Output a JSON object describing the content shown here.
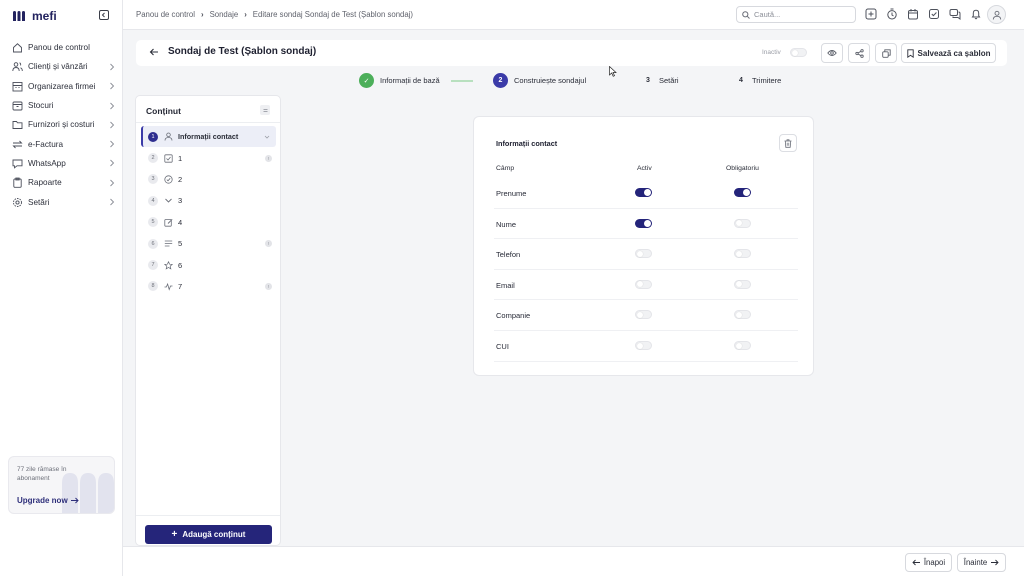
{
  "app": {
    "logo_text": "mefi"
  },
  "sidebar": {
    "items": [
      {
        "label": "Panou de control",
        "icon": "home-icon",
        "has_chevron": false
      },
      {
        "label": "Clienți și vânzări",
        "icon": "users-icon",
        "has_chevron": true
      },
      {
        "label": "Organizarea firmei",
        "icon": "building-icon",
        "has_chevron": true
      },
      {
        "label": "Stocuri",
        "icon": "box-icon",
        "has_chevron": true
      },
      {
        "label": "Furnizori și costuri",
        "icon": "folder-icon",
        "has_chevron": true
      },
      {
        "label": "e-Factura",
        "icon": "exchange-icon",
        "has_chevron": true
      },
      {
        "label": "WhatsApp",
        "icon": "chat-icon",
        "has_chevron": true
      },
      {
        "label": "Rapoarte",
        "icon": "clipboard-icon",
        "has_chevron": true
      },
      {
        "label": "Setări",
        "icon": "gear-icon",
        "has_chevron": true
      }
    ],
    "upgrade": {
      "text": "77 zile rămase în abonament",
      "link": "Upgrade now"
    }
  },
  "topbar": {
    "breadcrumb": [
      "Panou de control",
      "Sondaje",
      "Editare sondaj Sondaj de Test (Șablon sondaj)"
    ],
    "search_placeholder": "Caută..."
  },
  "header": {
    "title": "Sondaj de Test (Șablon sondaj)",
    "inactive_label": "Inactiv",
    "save_template_label": "Salvează ca șablon"
  },
  "stepper": [
    {
      "num": "✓",
      "label": "Informații de bază",
      "state": "done"
    },
    {
      "num": "2",
      "label": "Construiește sondajul",
      "state": "active"
    },
    {
      "num": "3",
      "label": "Setări",
      "state": "idle"
    },
    {
      "num": "4",
      "label": "Trimitere",
      "state": "idle"
    }
  ],
  "content_panel": {
    "title": "Conținut",
    "items": [
      {
        "num": "1",
        "label": "Informații contact",
        "icon": "person-icon",
        "selected": true,
        "required": false,
        "caret": true
      },
      {
        "num": "2",
        "label": "1",
        "icon": "checkbox-icon",
        "selected": false,
        "required": true,
        "caret": false
      },
      {
        "num": "3",
        "label": "2",
        "icon": "check-circle-icon",
        "selected": false,
        "required": false,
        "caret": false
      },
      {
        "num": "4",
        "label": "3",
        "icon": "chevron-down-icon",
        "selected": false,
        "required": false,
        "caret": false
      },
      {
        "num": "5",
        "label": "4",
        "icon": "edit-icon",
        "selected": false,
        "required": false,
        "caret": false
      },
      {
        "num": "6",
        "label": "5",
        "icon": "lines-icon",
        "selected": false,
        "required": true,
        "caret": false
      },
      {
        "num": "7",
        "label": "6",
        "icon": "star-icon",
        "selected": false,
        "required": false,
        "caret": false
      },
      {
        "num": "8",
        "label": "7",
        "icon": "pulse-icon",
        "selected": false,
        "required": true,
        "caret": false
      }
    ],
    "required_mark": "!",
    "add_button": "Adaugă conținut"
  },
  "contact_card": {
    "title": "Informații contact",
    "columns": {
      "field": "Câmp",
      "active": "Activ",
      "required": "Obligatoriu"
    },
    "rows": [
      {
        "label": "Prenume",
        "active": true,
        "required": true
      },
      {
        "label": "Nume",
        "active": true,
        "required": false
      },
      {
        "label": "Telefon",
        "active": false,
        "required": false
      },
      {
        "label": "Email",
        "active": false,
        "required": false
      },
      {
        "label": "Companie",
        "active": false,
        "required": false
      },
      {
        "label": "CUI",
        "active": false,
        "required": false
      }
    ]
  },
  "footer": {
    "back_label": "Înapoi",
    "next_label": "Înainte"
  },
  "colors": {
    "primary": "#25257a",
    "success": "#4caf5a"
  }
}
